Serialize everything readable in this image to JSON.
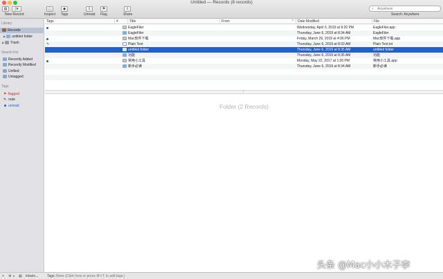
{
  "window": {
    "title": "Untitled — Records (8 records)"
  },
  "toolbar": {
    "new_record_label": "New Record",
    "inspect_label": "Inspect",
    "tags_label": "Tags",
    "unread_label": "Unread",
    "flag_label": "Flag",
    "share_label": "Share",
    "search_placeholder": "Anywhere",
    "search_scope": "Search: Anywhere"
  },
  "sidebar": {
    "library_header": "Library",
    "library_items": [
      {
        "label": "Records",
        "icon": "library-icon",
        "selected": true
      },
      {
        "label": "untitled folder",
        "icon": "folder-icon"
      },
      {
        "label": "Trash",
        "icon": "trash-icon"
      }
    ],
    "search_header": "Search For",
    "search_items": [
      {
        "label": "Recently Added",
        "icon": "smart-folder-icon"
      },
      {
        "label": "Recently Modified",
        "icon": "smart-folder-icon"
      },
      {
        "label": "Unfiled",
        "icon": "smart-folder-icon"
      },
      {
        "label": "Untagged",
        "icon": "smart-folder-icon"
      }
    ],
    "tags_header": "Tags",
    "tag_items": [
      {
        "label": "flagged",
        "icon": "flag-icon",
        "color": "#e0412c"
      },
      {
        "label": "note",
        "icon": "pencil-icon"
      },
      {
        "label": "unread",
        "icon": "unread-dot-icon",
        "color": "#2b57d9"
      }
    ]
  },
  "table": {
    "columns": [
      "Tags",
      "#",
      "Title",
      "From",
      "Date Modified",
      "File"
    ],
    "rows": [
      {
        "tag": "unread",
        "icon": "app-icon",
        "title": "EagleFiler",
        "from": "",
        "date": "Wednesday, April 3, 2019 at 9:20 PM",
        "file": "EagleFiler.app"
      },
      {
        "tag": "",
        "icon": "folder-icon",
        "title": "EagleFiler",
        "from": "",
        "date": "Thursday, June 6, 2019 at 8:34 AM",
        "file": "EagleFiler"
      },
      {
        "tag": "unread",
        "icon": "app-icon",
        "title": "Mac软件下载",
        "from": "",
        "date": "Friday, March 29, 2019 at 4:06 PM",
        "file": "Mac软件下载.app"
      },
      {
        "tag": "note",
        "icon": "doc-icon",
        "title": "Plain Text",
        "from": "",
        "date": "Thursday, June 6, 2019 at 8:33 AM",
        "file": "Plain Text.txt"
      },
      {
        "tag": "",
        "icon": "folder-icon",
        "title": "untitled folder",
        "from": "",
        "date": "Thursday, June 6, 2019 at 8:35 AM",
        "file": "untitled folder",
        "selected": true
      },
      {
        "tag": "",
        "icon": "folder-icon",
        "title": "功能",
        "from": "",
        "date": "Thursday, June 6, 2019 at 8:35 AM",
        "file": "功能"
      },
      {
        "tag": "unread",
        "icon": "app-icon",
        "title": "常用小工具",
        "from": "",
        "date": "Monday, May 22, 2017 at 1:20 PM",
        "file": "常用小工具.app"
      },
      {
        "tag": "",
        "icon": "folder-icon",
        "title": "新手必读",
        "from": "",
        "date": "Thursday, June 6, 2019 at 8:34 AM",
        "file": "新手必读"
      }
    ]
  },
  "preview": {
    "title": "Folder (2 Records)"
  },
  "bottombar": {
    "add_label": "+",
    "gear_label": "⚙",
    "library_name": "inlaxin...",
    "tags_label": "Tags:",
    "tags_placeholder": "None (Click here or press ⌘⇧T to add tags.)"
  },
  "watermark": {
    "text": "头条 @Mac小小木子李"
  },
  "colors": {
    "selection": "#1f5fd6",
    "unread": "#2b57d9",
    "flag": "#e0412c",
    "folder": "#76b0e8"
  }
}
